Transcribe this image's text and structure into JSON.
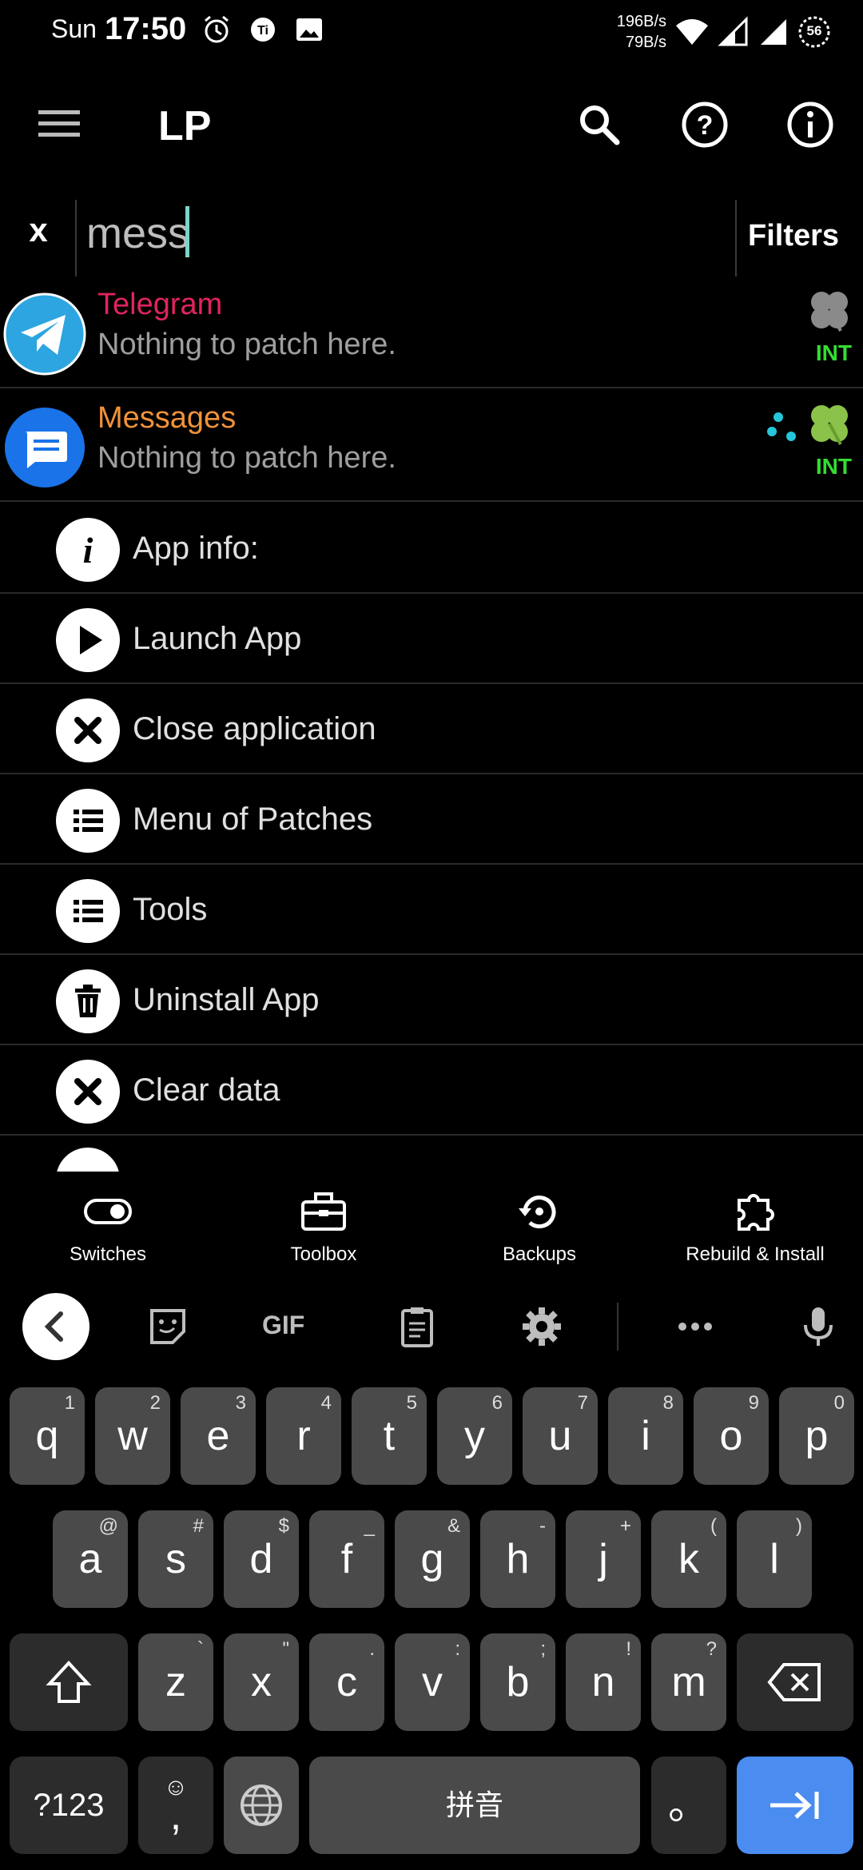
{
  "status_bar": {
    "day": "Sun",
    "time": "17:50",
    "speed_up": "196B/s",
    "speed_down": "79B/s",
    "battery": "56"
  },
  "app_bar": {
    "title": "LP"
  },
  "search": {
    "clear_label": "x",
    "value": "mess",
    "filters_label": "Filters"
  },
  "apps": [
    {
      "name": "Telegram",
      "status": "Nothing to patch here.",
      "badge": "INT",
      "name_color": "#e0245e"
    },
    {
      "name": "Messages",
      "status": "Nothing to patch here.",
      "badge": "INT",
      "name_color": "#f0923a"
    }
  ],
  "context_menu": [
    {
      "label": "App info:",
      "icon": "info-icon"
    },
    {
      "label": "Launch App",
      "icon": "play-icon"
    },
    {
      "label": "Close application",
      "icon": "close-icon"
    },
    {
      "label": "Menu of Patches",
      "icon": "list-icon"
    },
    {
      "label": "Tools",
      "icon": "list-icon"
    },
    {
      "label": "Uninstall App",
      "icon": "trash-icon"
    },
    {
      "label": "Clear data",
      "icon": "close-icon"
    }
  ],
  "bottom_nav": [
    {
      "label": "Switches",
      "icon": "toggle-icon"
    },
    {
      "label": "Toolbox",
      "icon": "toolbox-icon"
    },
    {
      "label": "Backups",
      "icon": "backup-icon"
    },
    {
      "label": "Rebuild & Install",
      "icon": "puzzle-icon"
    }
  ],
  "keyboard": {
    "toolbar": {
      "gif_label": "GIF"
    },
    "row1": [
      {
        "key": "q",
        "sup": "1"
      },
      {
        "key": "w",
        "sup": "2"
      },
      {
        "key": "e",
        "sup": "3"
      },
      {
        "key": "r",
        "sup": "4"
      },
      {
        "key": "t",
        "sup": "5"
      },
      {
        "key": "y",
        "sup": "6"
      },
      {
        "key": "u",
        "sup": "7"
      },
      {
        "key": "i",
        "sup": "8"
      },
      {
        "key": "o",
        "sup": "9"
      },
      {
        "key": "p",
        "sup": "0"
      }
    ],
    "row2": [
      {
        "key": "a",
        "sup": "@"
      },
      {
        "key": "s",
        "sup": "#"
      },
      {
        "key": "d",
        "sup": "$"
      },
      {
        "key": "f",
        "sup": "_"
      },
      {
        "key": "g",
        "sup": "&"
      },
      {
        "key": "h",
        "sup": "-"
      },
      {
        "key": "j",
        "sup": "+"
      },
      {
        "key": "k",
        "sup": "("
      },
      {
        "key": "l",
        "sup": ")"
      }
    ],
    "row3": [
      {
        "key": "z",
        "sup": "`"
      },
      {
        "key": "x",
        "sup": "\""
      },
      {
        "key": "c",
        "sup": "."
      },
      {
        "key": "v",
        "sup": ":"
      },
      {
        "key": "b",
        "sup": ";"
      },
      {
        "key": "n",
        "sup": "!"
      },
      {
        "key": "m",
        "sup": "?"
      }
    ],
    "symbols_label": "?123",
    "comma_label": ",",
    "space_label": "拼音",
    "period_label": "。"
  }
}
